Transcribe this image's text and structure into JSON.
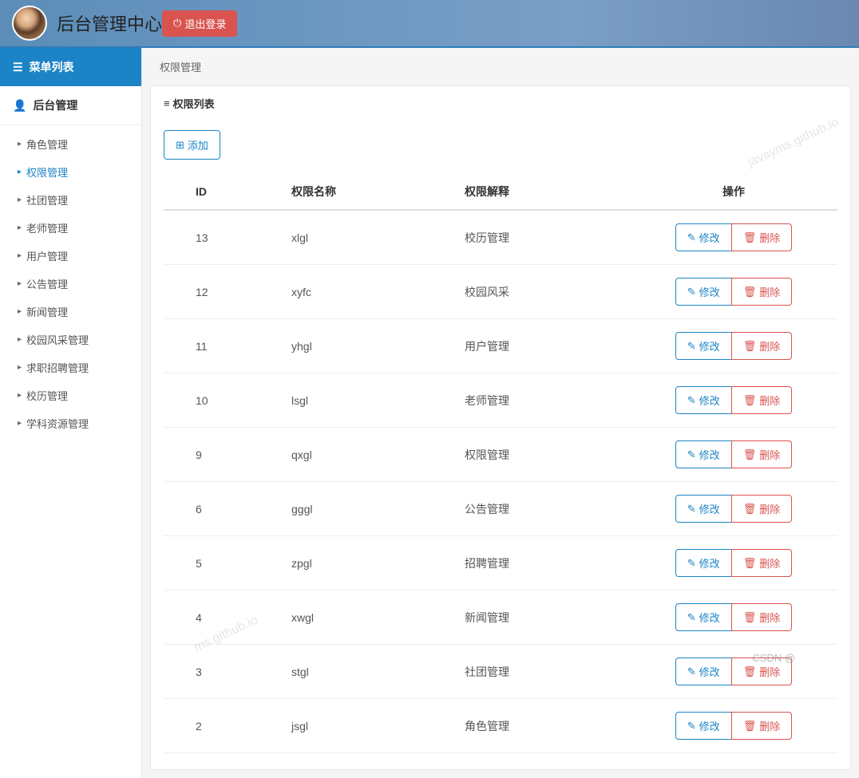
{
  "header": {
    "title": "后台管理中心",
    "logout_label": "退出登录"
  },
  "sidebar": {
    "menu_header": "菜单列表",
    "section_label": "后台管理",
    "items": [
      {
        "label": "角色管理",
        "active": false
      },
      {
        "label": "权限管理",
        "active": true
      },
      {
        "label": "社团管理",
        "active": false
      },
      {
        "label": "老师管理",
        "active": false
      },
      {
        "label": "用户管理",
        "active": false
      },
      {
        "label": "公告管理",
        "active": false
      },
      {
        "label": "新闻管理",
        "active": false
      },
      {
        "label": "校园风采管理",
        "active": false
      },
      {
        "label": "求职招聘管理",
        "active": false
      },
      {
        "label": "校历管理",
        "active": false
      },
      {
        "label": "学科资源管理",
        "active": false
      }
    ]
  },
  "breadcrumb": "权限管理",
  "panel": {
    "title": "权限列表",
    "add_label": "添加",
    "columns": {
      "id": "ID",
      "name": "权限名称",
      "desc": "权限解释",
      "ops": "操作"
    },
    "edit_label": "修改",
    "delete_label": "删除",
    "rows": [
      {
        "id": "13",
        "name": "xlgl",
        "desc": "校历管理"
      },
      {
        "id": "12",
        "name": "xyfc",
        "desc": "校园风采"
      },
      {
        "id": "11",
        "name": "yhgl",
        "desc": "用户管理"
      },
      {
        "id": "10",
        "name": "lsgl",
        "desc": "老师管理"
      },
      {
        "id": "9",
        "name": "qxgl",
        "desc": "权限管理"
      },
      {
        "id": "6",
        "name": "gggl",
        "desc": "公告管理"
      },
      {
        "id": "5",
        "name": "zpgl",
        "desc": "招聘管理"
      },
      {
        "id": "4",
        "name": "xwgl",
        "desc": "新闻管理"
      },
      {
        "id": "3",
        "name": "stgl",
        "desc": "社团管理"
      },
      {
        "id": "2",
        "name": "jsgl",
        "desc": "角色管理"
      }
    ]
  },
  "watermarks": {
    "wm1": "javayms.github.io",
    "wm2": "ms.github.io",
    "wm3": "CSDN @"
  }
}
